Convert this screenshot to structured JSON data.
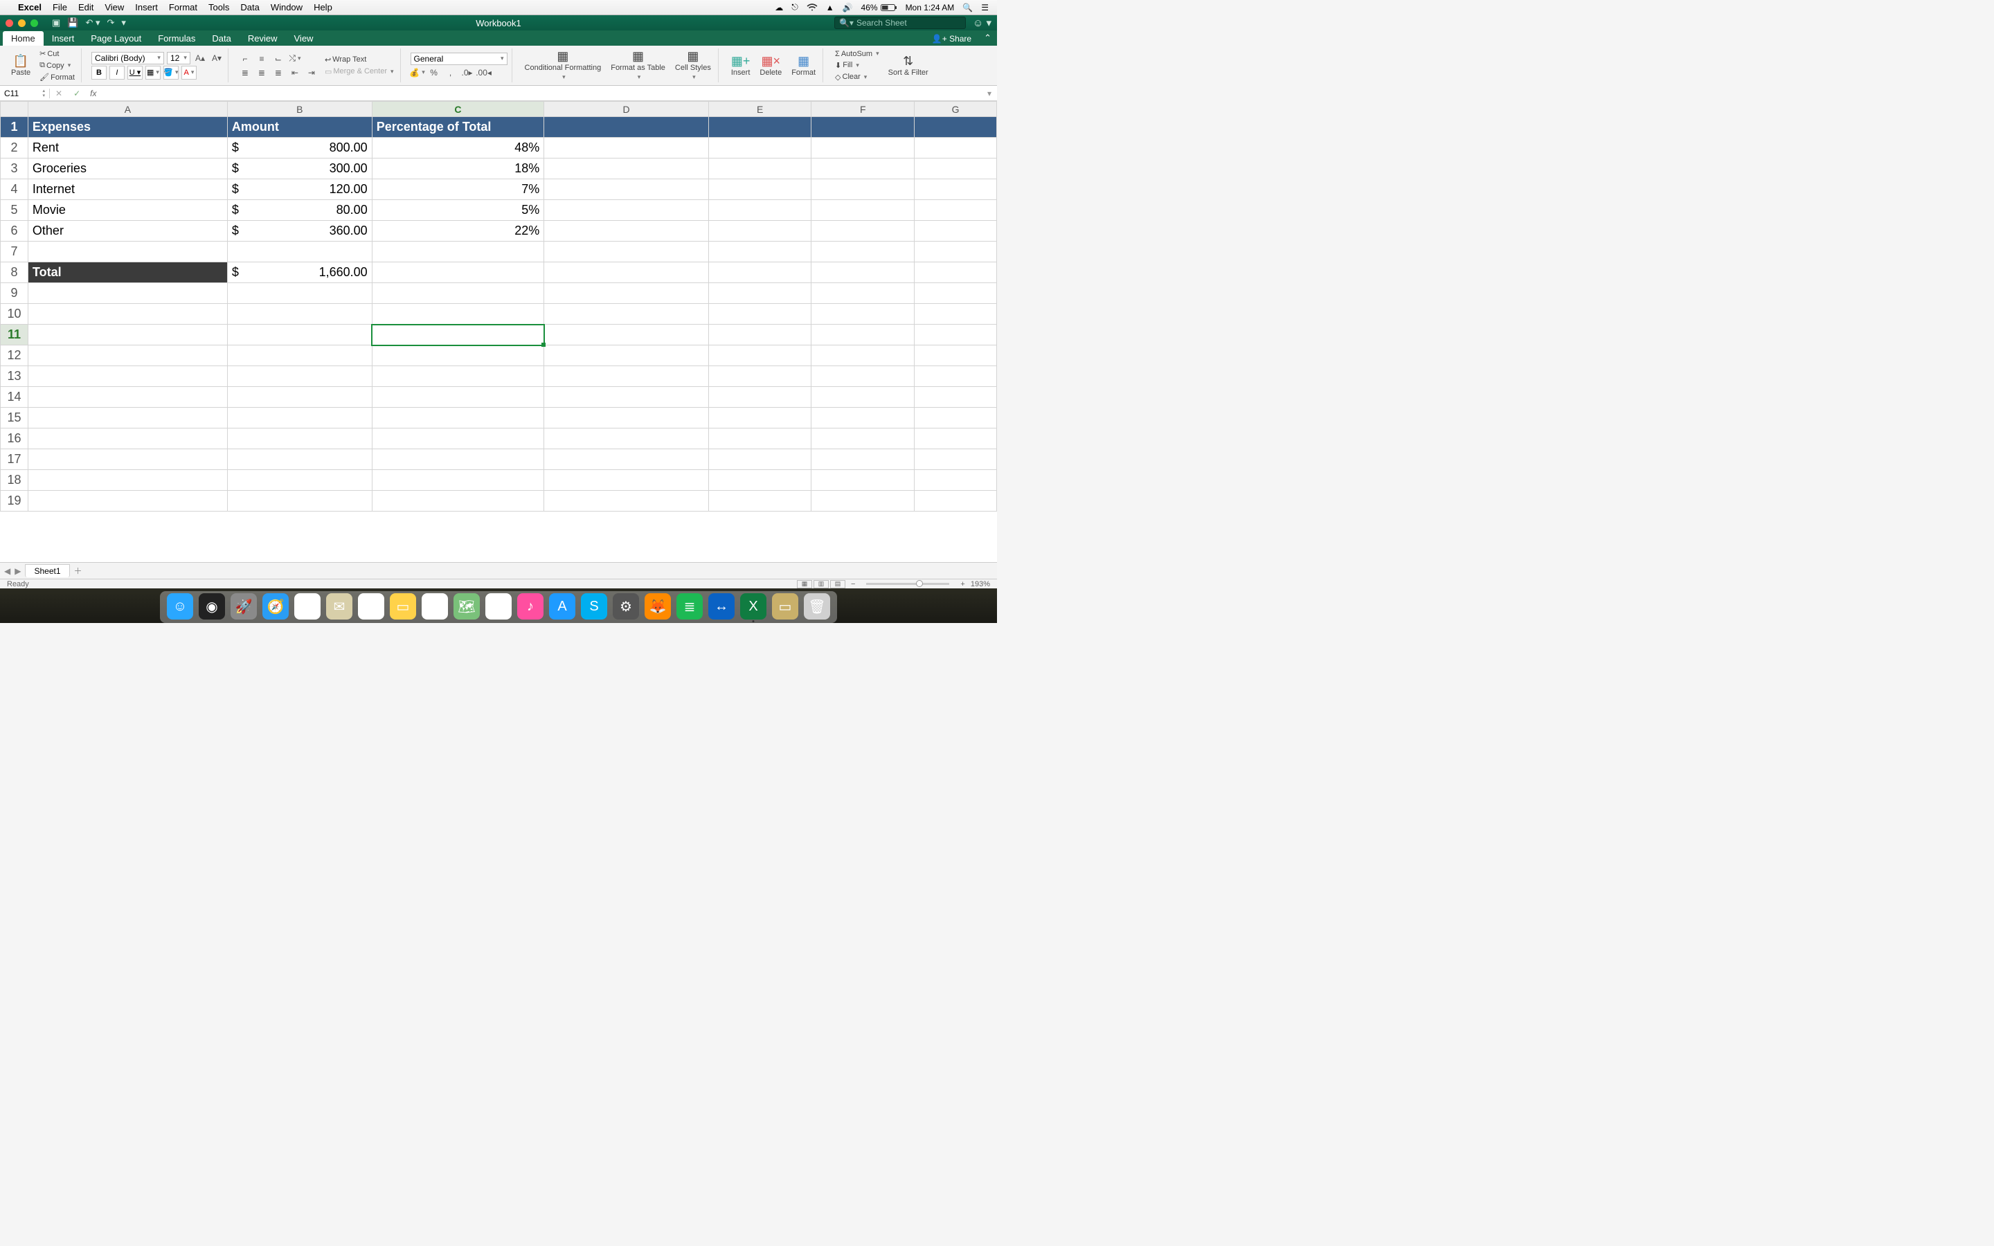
{
  "mac_menu": {
    "app": "Excel",
    "items": [
      "File",
      "Edit",
      "View",
      "Insert",
      "Format",
      "Tools",
      "Data",
      "Window",
      "Help"
    ],
    "battery": "46%",
    "clock": "Mon 1:24 AM"
  },
  "window": {
    "title": "Workbook1",
    "search_placeholder": "Search Sheet"
  },
  "ribbon_tabs": [
    "Home",
    "Insert",
    "Page Layout",
    "Formulas",
    "Data",
    "Review",
    "View"
  ],
  "share_label": "Share",
  "ribbon": {
    "paste": "Paste",
    "cut": "Cut",
    "copy": "Copy",
    "format_painter": "Format",
    "font_name": "Calibri (Body)",
    "font_size": "12",
    "wrap": "Wrap Text",
    "merge": "Merge & Center",
    "number_format": "General",
    "cond_fmt": "Conditional Formatting",
    "fmt_table": "Format as Table",
    "cell_styles": "Cell Styles",
    "insert": "Insert",
    "delete": "Delete",
    "format": "Format",
    "autosum": "AutoSum",
    "fill": "Fill",
    "clear": "Clear",
    "sort": "Sort & Filter"
  },
  "formula_bar": {
    "name_box": "C11",
    "formula": ""
  },
  "columns": [
    "A",
    "B",
    "C",
    "D",
    "E",
    "F",
    "G"
  ],
  "rows": [
    "1",
    "2",
    "3",
    "4",
    "5",
    "6",
    "7",
    "8",
    "9",
    "10",
    "11",
    "12",
    "13",
    "14",
    "15",
    "16",
    "17",
    "18",
    "19"
  ],
  "active_cell": {
    "row": 11,
    "col": "C"
  },
  "table": {
    "headers": {
      "a": "Expenses",
      "b": "Amount",
      "c": "Percentage of Total"
    },
    "data": [
      {
        "a": "Rent",
        "b_sym": "$",
        "b_val": "800.00",
        "c": "48%"
      },
      {
        "a": "Groceries",
        "b_sym": "$",
        "b_val": "300.00",
        "c": "18%"
      },
      {
        "a": "Internet",
        "b_sym": "$",
        "b_val": "120.00",
        "c": "7%"
      },
      {
        "a": "Movie",
        "b_sym": "$",
        "b_val": "80.00",
        "c": "5%"
      },
      {
        "a": "Other",
        "b_sym": "$",
        "b_val": "360.00",
        "c": "22%"
      }
    ],
    "total": {
      "a": "Total",
      "b_sym": "$",
      "b_val": "1,660.00"
    }
  },
  "sheet_tabs": {
    "active": "Sheet1"
  },
  "status": {
    "ready": "Ready",
    "zoom": "193%"
  },
  "dock": [
    {
      "name": "finder",
      "bg": "#2aa7ff",
      "glyph": "☺"
    },
    {
      "name": "siri",
      "bg": "#222",
      "glyph": "◉"
    },
    {
      "name": "launchpad",
      "bg": "#8a8a8a",
      "glyph": "🚀"
    },
    {
      "name": "safari",
      "bg": "#2a9df4",
      "glyph": "🧭"
    },
    {
      "name": "chrome",
      "bg": "#fff",
      "glyph": "◎"
    },
    {
      "name": "mail",
      "bg": "#d8cfa9",
      "glyph": "✉"
    },
    {
      "name": "calendar",
      "bg": "#fff",
      "glyph": "5"
    },
    {
      "name": "notes",
      "bg": "#ffd24a",
      "glyph": "▭"
    },
    {
      "name": "reminders",
      "bg": "#fff",
      "glyph": "☑"
    },
    {
      "name": "maps",
      "bg": "#7ac17a",
      "glyph": "🗺"
    },
    {
      "name": "photos",
      "bg": "#fff",
      "glyph": "✿"
    },
    {
      "name": "itunes",
      "bg": "#ff4fa0",
      "glyph": "♪"
    },
    {
      "name": "appstore",
      "bg": "#1f9bff",
      "glyph": "A"
    },
    {
      "name": "skype",
      "bg": "#00aff0",
      "glyph": "S"
    },
    {
      "name": "settings",
      "bg": "#555",
      "glyph": "⚙"
    },
    {
      "name": "firefox",
      "bg": "#ff8a00",
      "glyph": "🦊"
    },
    {
      "name": "spotify",
      "bg": "#1db954",
      "glyph": "≣"
    },
    {
      "name": "teamviewer",
      "bg": "#0a62c4",
      "glyph": "↔"
    },
    {
      "name": "excel",
      "bg": "#107c41",
      "glyph": "X",
      "running": true
    },
    {
      "name": "zip",
      "bg": "#c9b06a",
      "glyph": "▭"
    },
    {
      "name": "trash",
      "bg": "#d0d0d0",
      "glyph": "🗑"
    }
  ]
}
